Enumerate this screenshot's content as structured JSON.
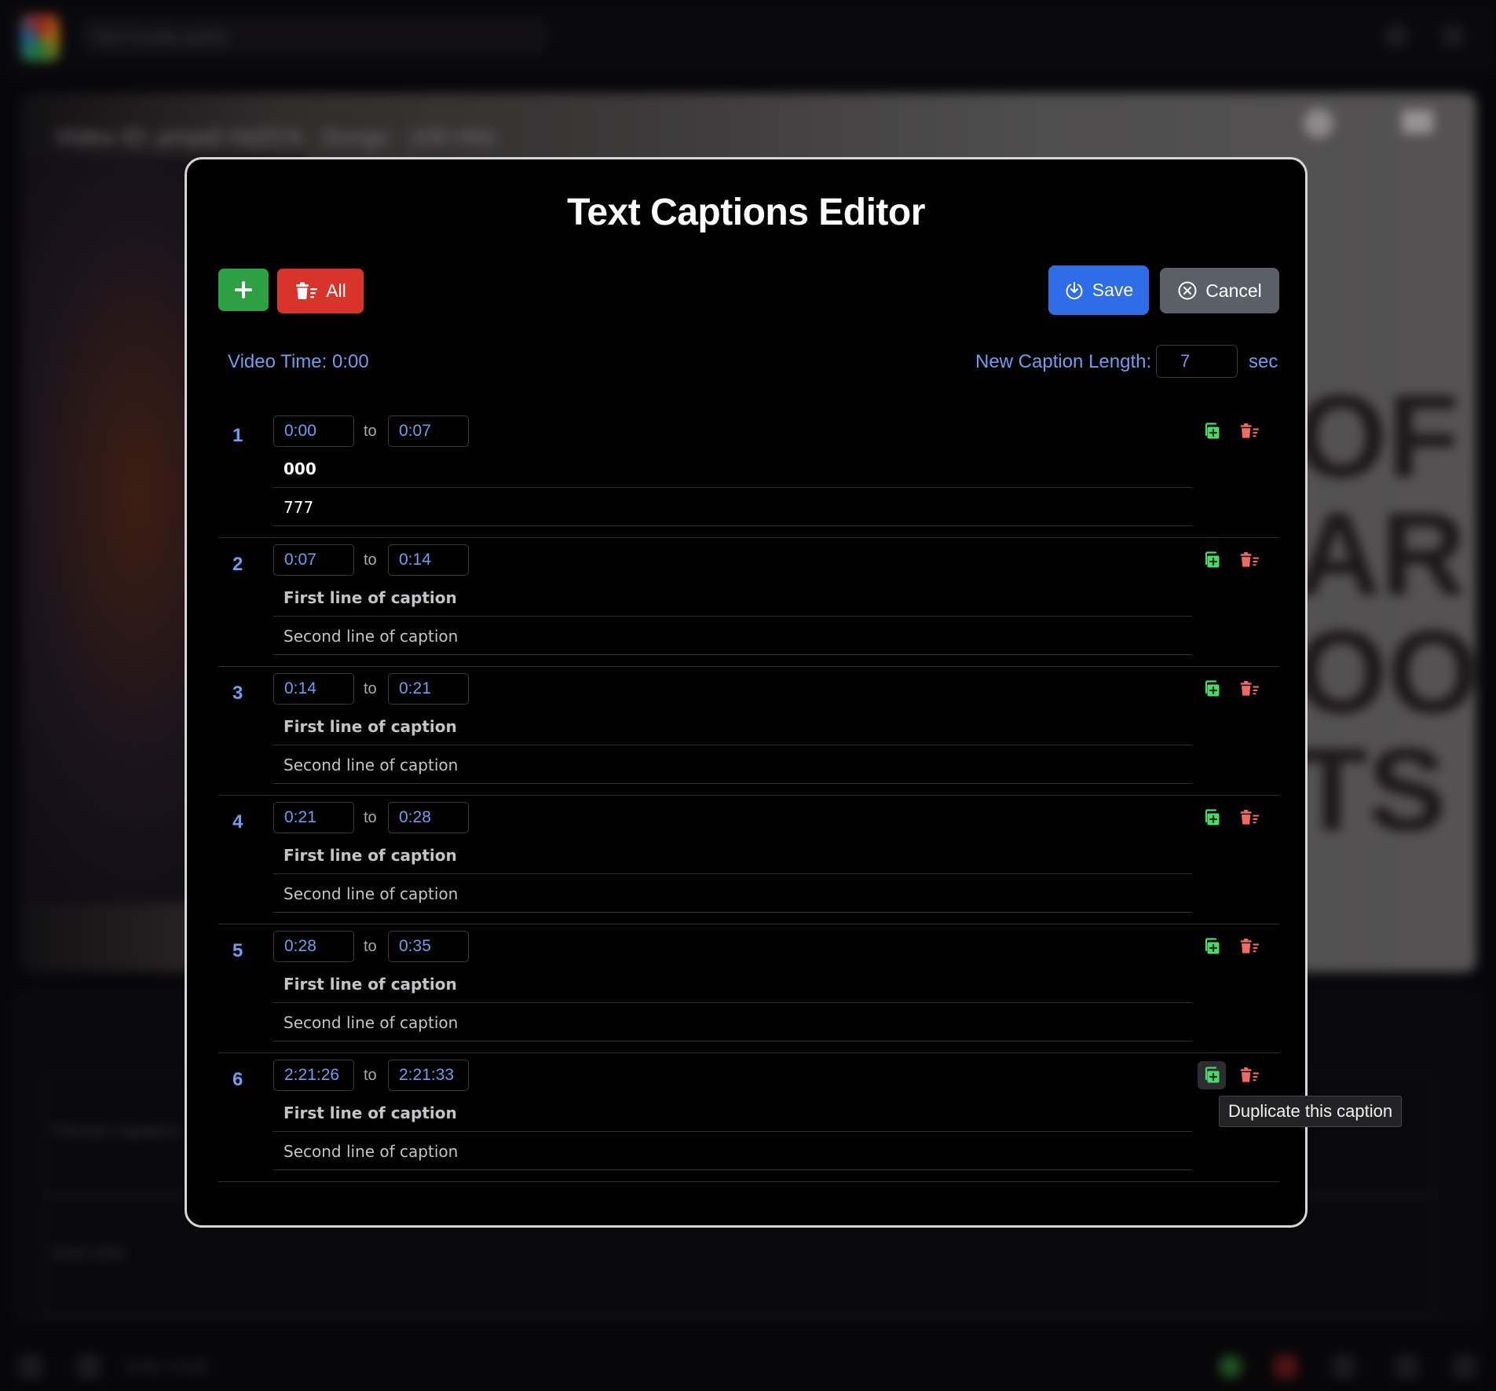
{
  "background": {
    "search_placeholder": "Text to play guitar",
    "video_title": "Video ID: pmpdi Hd3Y4 · Songs · 100 Hits",
    "big_text": "OF\nAR\nOO\nTS",
    "panel_rows": [
      "Chords Captions",
      "Auto-Gen"
    ],
    "bottom_time": "0:00 / 0:00"
  },
  "modal": {
    "title": "Text Captions Editor",
    "toolbar": {
      "add_icon": "plus-icon",
      "delete_all_label": "All",
      "delete_all_icon": "trash-list-icon",
      "save_label": "Save",
      "save_icon": "download-circle-icon",
      "cancel_label": "Cancel",
      "cancel_icon": "x-circle-icon"
    },
    "video_time_label": "Video Time: 0:00",
    "new_caption_length": {
      "label": "New Caption Length:",
      "value": "7",
      "unit": "sec"
    },
    "to_label": "to",
    "captions": [
      {
        "num": "1",
        "from": "0:00",
        "to": "0:07",
        "line1": "000",
        "line2": "777"
      },
      {
        "num": "2",
        "from": "0:07",
        "to": "0:14",
        "line1": "First line of caption",
        "line2": "Second line of caption"
      },
      {
        "num": "3",
        "from": "0:14",
        "to": "0:21",
        "line1": "First line of caption",
        "line2": "Second line of caption"
      },
      {
        "num": "4",
        "from": "0:21",
        "to": "0:28",
        "line1": "First line of caption",
        "line2": "Second line of caption"
      },
      {
        "num": "5",
        "from": "0:28",
        "to": "0:35",
        "line1": "First line of caption",
        "line2": "Second line of caption"
      },
      {
        "num": "6",
        "from": "2:21:26",
        "to": "2:21:33",
        "line1": "First line of caption",
        "line2": "Second line of caption"
      }
    ],
    "row_icons": {
      "duplicate": "duplicate-plus-icon",
      "delete": "trash-list-icon"
    },
    "tooltip": "Duplicate this caption",
    "colors": {
      "accent_blue": "#6d9eef",
      "add_green": "#2ea043",
      "delete_red": "#d9342b",
      "save_blue": "#2f6de8",
      "cancel_gray": "#5a5f68",
      "icon_green": "#4fd86a",
      "icon_red": "#f06a63"
    }
  }
}
